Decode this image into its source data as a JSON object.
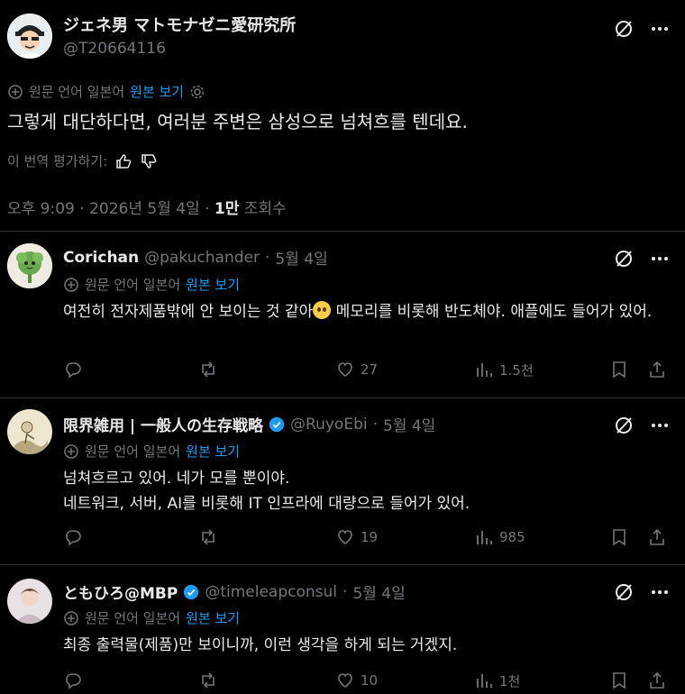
{
  "main_tweet": {
    "display_name": "ジェネ男 マトモナゼニ愛研究所",
    "handle": "@T20664116",
    "translation": {
      "language_note": "원문 언어 일본어",
      "view_original": "원본 보기"
    },
    "text": "그렇게 대단하다면, 여러분 주변은 삼성으로 넘쳐흐를 텐데요.",
    "rate_label": "이 번역 평가하기:",
    "time": "오후 9:09",
    "date": "2026년 5월 4일",
    "views_count": "1만",
    "views_label": "조회수"
  },
  "replies": [
    {
      "display_name": "Corichan",
      "handle": "@pakuchander",
      "date": "5월 4일",
      "verified": false,
      "translation": {
        "language_note": "원문 언어 일본어",
        "view_original": "원본 보기"
      },
      "text_before_emoji": "여전히 전자제품밖에 안 보이는 것 같아",
      "text_after_emoji": " 메모리를 비롯해 반도체야. 애플에도 들어가 있어.",
      "reply_count": "",
      "repost_count": "",
      "like_count": "27",
      "view_count": "1.5천"
    },
    {
      "display_name": "限界雑用 | 一般人の生存戦略",
      "handle": "@RuyoEbi",
      "date": "5월 4일",
      "verified": true,
      "translation": {
        "language_note": "원문 언어 일본어",
        "view_original": "원본 보기"
      },
      "text_line1": "넘쳐흐르고 있어. 네가 모를 뿐이야.",
      "text_line2": "네트워크, 서버, AI를 비롯해 IT 인프라에 대량으로 들어가 있어.",
      "reply_count": "",
      "repost_count": "",
      "like_count": "19",
      "view_count": "985"
    },
    {
      "display_name": "ともひろ@MBP",
      "handle": "@timeleapconsul",
      "date": "5월 4일",
      "verified": true,
      "translation": {
        "language_note": "원문 언어 일본어",
        "view_original": "원본 보기"
      },
      "text": "최종 출력물(제품)만 보이니까, 이런 생각을 하게 되는 거겠지.",
      "reply_count": "",
      "repost_count": "",
      "like_count": "10",
      "view_count": "1천"
    }
  ],
  "icons": {
    "translate": "translate-icon",
    "gear": "gear-icon",
    "grok": "grok-icon",
    "more": "more-icon",
    "reply": "reply-icon",
    "repost": "repost-icon",
    "like": "like-icon",
    "views": "views-icon",
    "bookmark": "bookmark-icon",
    "share": "share-icon",
    "thumbs_up": "thumbs-up-icon",
    "thumbs_down": "thumbs-down-icon",
    "verified": "verified-badge-icon"
  },
  "colors": {
    "background": "#000000",
    "text": "#e7e9ea",
    "muted": "#71767b",
    "link": "#1d9bf0",
    "divider": "#2f3336",
    "verified": "#1d9bf0"
  }
}
